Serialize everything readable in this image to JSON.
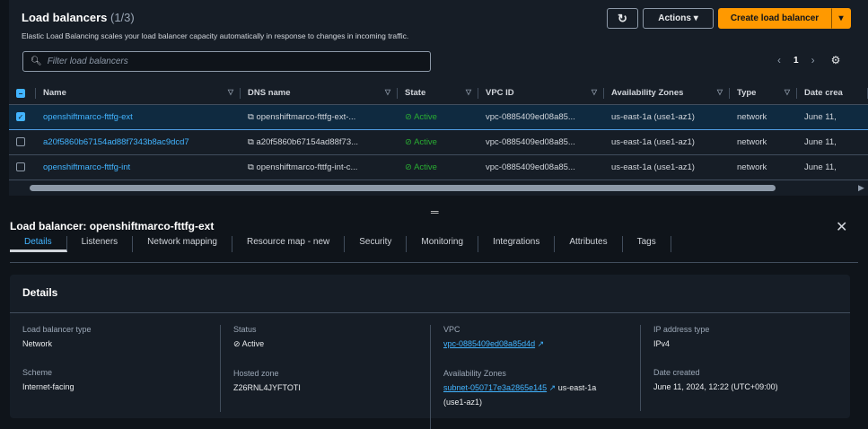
{
  "header": {
    "title": "Load balancers",
    "count": "(1/3)",
    "description": "Elastic Load Balancing scales your load balancer capacity automatically in response to changes in incoming traffic.",
    "filter_placeholder": "Filter load balancers",
    "actions": "Actions",
    "create": "Create load balancer",
    "page": "1"
  },
  "columns": [
    "Name",
    "DNS name",
    "State",
    "VPC ID",
    "Availability Zones",
    "Type",
    "Date crea"
  ],
  "rows": [
    {
      "name": "openshiftmarco-fttfg-ext",
      "dns": "openshiftmarco-fttfg-ext-...",
      "state": "Active",
      "vpc": "vpc-0885409ed08a85...",
      "az": "us-east-1a (use1-az1)",
      "type": "network",
      "date": "June 11,",
      "selected": true
    },
    {
      "name": "a20f5860b67154ad88f7343b8ac9dcd7",
      "dns": "a20f5860b67154ad88f73...",
      "state": "Active",
      "vpc": "vpc-0885409ed08a85...",
      "az": "us-east-1a (use1-az1)",
      "type": "network",
      "date": "June 11,",
      "selected": false
    },
    {
      "name": "openshiftmarco-fttfg-int",
      "dns": "openshiftmarco-fttfg-int-c...",
      "state": "Active",
      "vpc": "vpc-0885409ed08a85...",
      "az": "us-east-1a (use1-az1)",
      "type": "network",
      "date": "June 11,",
      "selected": false
    }
  ],
  "detail": {
    "title": "Load balancer: openshiftmarco-fttfg-ext",
    "tabs": [
      "Details",
      "Listeners",
      "Network mapping",
      "Resource map - new",
      "Security",
      "Monitoring",
      "Integrations",
      "Attributes",
      "Tags"
    ],
    "section": "Details",
    "fields": {
      "lb_type_label": "Load balancer type",
      "lb_type": "Network",
      "scheme_label": "Scheme",
      "scheme": "Internet-facing",
      "status_label": "Status",
      "status": "Active",
      "hosted_label": "Hosted zone",
      "hosted": "Z26RNL4JYFTOTI",
      "vpc_label": "VPC",
      "vpc": "vpc-0885409ed08a85d4d",
      "az_label": "Availability Zones",
      "subnet": "subnet-050717e3a2865e145",
      "az": "us-east-1a",
      "az_id": "(use1-az1)",
      "ip_label": "IP address type",
      "ip": "IPv4",
      "date_label": "Date created",
      "date": "June 11, 2024, 12:22 (UTC+09:00)"
    }
  }
}
